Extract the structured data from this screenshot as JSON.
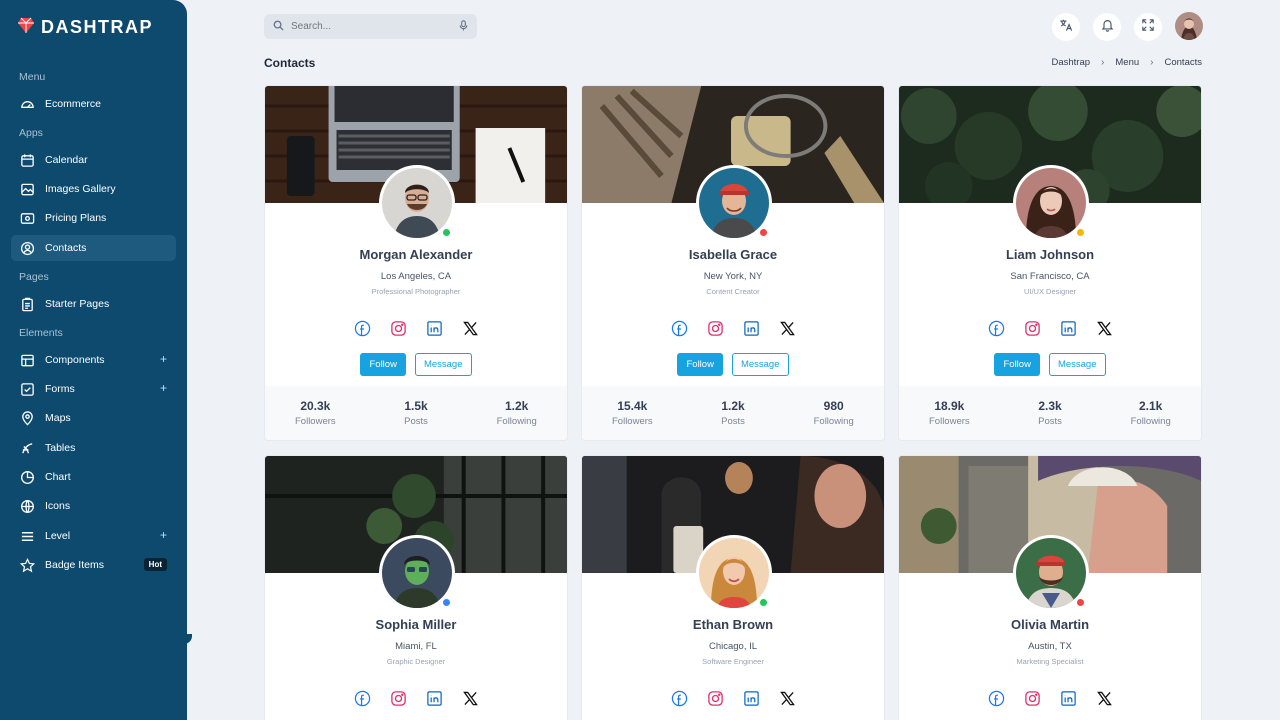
{
  "brand": {
    "name": "DASHTRAP"
  },
  "sidebar": {
    "sections": [
      "Menu",
      "Apps",
      "Pages",
      "Elements"
    ],
    "items": [
      {
        "label": "Ecommerce",
        "icon": "dashboard-icon"
      },
      {
        "label": "Calendar",
        "icon": "calendar-icon"
      },
      {
        "label": "Images Gallery",
        "icon": "image-icon"
      },
      {
        "label": "Pricing Plans",
        "icon": "pricing-icon"
      },
      {
        "label": "Contacts",
        "icon": "contact-icon",
        "active": true
      },
      {
        "label": "Starter Pages",
        "icon": "clipboard-icon"
      },
      {
        "label": "Components",
        "icon": "components-icon",
        "expand": "+"
      },
      {
        "label": "Forms",
        "icon": "forms-icon",
        "expand": "+"
      },
      {
        "label": "Maps",
        "icon": "map-pin-icon"
      },
      {
        "label": "Tables",
        "icon": "tables-icon"
      },
      {
        "label": "Chart",
        "icon": "chart-icon"
      },
      {
        "label": "Icons",
        "icon": "icons-icon"
      },
      {
        "label": "Level",
        "icon": "menu-icon",
        "expand": "+"
      },
      {
        "label": "Badge Items",
        "icon": "star-icon",
        "badge": "Hot"
      }
    ]
  },
  "search": {
    "placeholder": "Search..."
  },
  "header": {
    "title": "Contacts",
    "breadcrumb": [
      "Dashtrap",
      "Menu",
      "Contacts"
    ]
  },
  "labels": {
    "follow": "Follow",
    "message": "Message",
    "followers": "Followers",
    "posts": "Posts",
    "following": "Following"
  },
  "contacts": [
    {
      "name": "Morgan Alexander",
      "location": "Los Angeles, CA",
      "role": "Professional Photographer",
      "followers": "20.3k",
      "posts": "1.5k",
      "following": "1.2k",
      "status_color": "#22c55e"
    },
    {
      "name": "Isabella Grace",
      "location": "New York, NY",
      "role": "Content Creator",
      "followers": "15.4k",
      "posts": "1.2k",
      "following": "980",
      "status_color": "#ef4444"
    },
    {
      "name": "Liam Johnson",
      "location": "San Francisco, CA",
      "role": "UI/UX Designer",
      "followers": "18.9k",
      "posts": "2.3k",
      "following": "2.1k",
      "status_color": "#f5b50a"
    },
    {
      "name": "Sophia Miller",
      "location": "Miami, FL",
      "role": "Graphic Designer",
      "status_color": "#3b82f6"
    },
    {
      "name": "Ethan Brown",
      "location": "Chicago, IL",
      "role": "Software Engineer",
      "status_color": "#22c55e"
    },
    {
      "name": "Olivia Martin",
      "location": "Austin, TX",
      "role": "Marketing Specialist",
      "status_color": "#ef4444"
    }
  ],
  "colors": {
    "sidebar": "#0e4a6e",
    "accent": "#16a3df",
    "facebook": "#1877f2",
    "instagram": "#e1306c",
    "linkedin": "#0a66c2",
    "x": "#111111"
  }
}
